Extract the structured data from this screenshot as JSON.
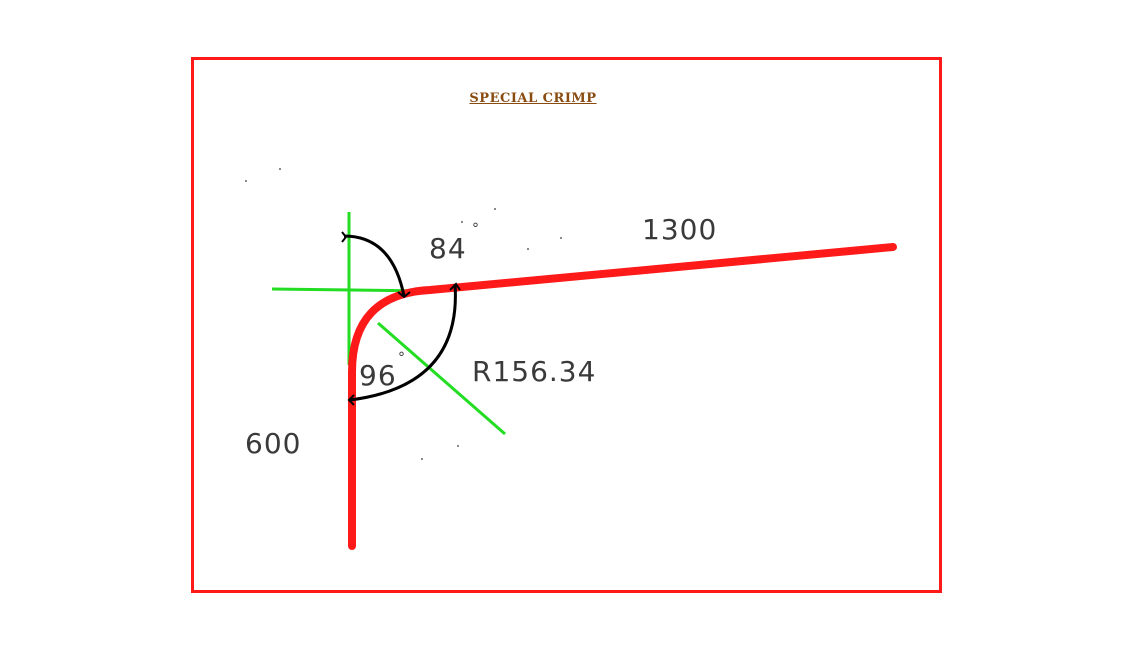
{
  "title": "SPECIAL CRIMP",
  "dimensions": {
    "long_leg": "1300",
    "short_leg": "600",
    "radius": "R156.34",
    "angle_top": "84",
    "angle_bottom": "96",
    "degree_symbol": "°"
  },
  "colors": {
    "frame": "#ff1a1a",
    "profile": "#ff1a1a",
    "construction": "#22dd22",
    "dimension_arcs": "#000000",
    "title": "#8a4b10"
  }
}
